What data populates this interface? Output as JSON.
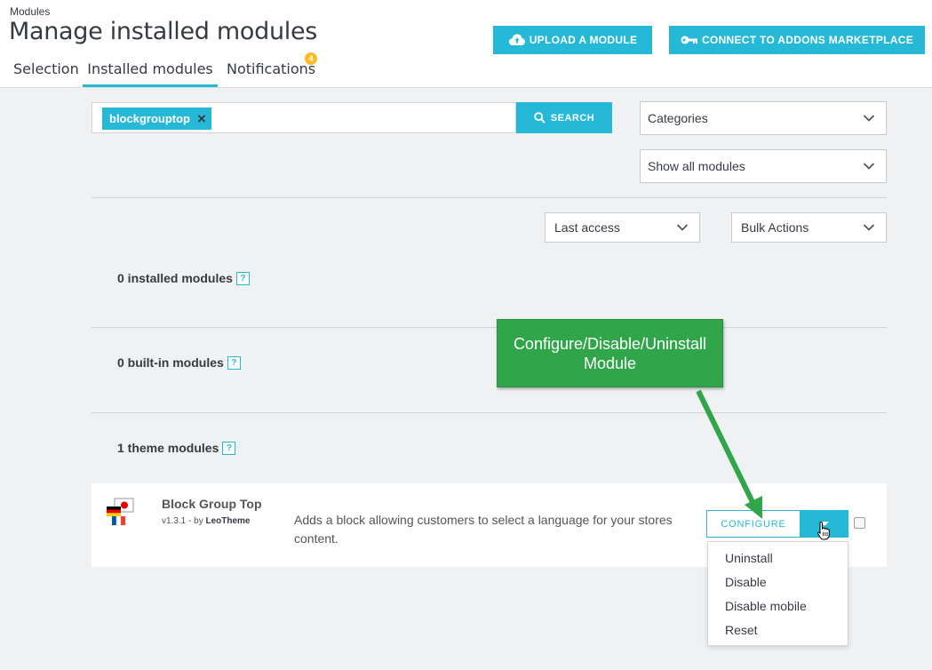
{
  "header": {
    "breadcrumb": "Modules",
    "title": "Manage installed modules",
    "tabs": [
      {
        "label": "Selection",
        "active": false
      },
      {
        "label": "Installed modules",
        "active": true
      },
      {
        "label": "Notifications",
        "active": false
      }
    ],
    "notification_count": "4",
    "upload_label": "UPLOAD A MODULE",
    "connect_label": "CONNECT TO ADDONS MARKETPLACE",
    "accent_color": "#25b9d7"
  },
  "filters": {
    "search_tag": "blockgrouptop",
    "search_label": "SEARCH",
    "categories": "Categories",
    "show_all": "Show all modules",
    "sort": "Last access",
    "bulk_actions": "Bulk Actions"
  },
  "sections": [
    {
      "title": "0 installed modules"
    },
    {
      "title": "0 built-in modules"
    },
    {
      "title": "1 theme modules"
    }
  ],
  "module": {
    "name": "Block Group Top",
    "version": "v1.3.1 - by",
    "author": "LeoTheme",
    "description": "Adds a block allowing customers to select a language for your stores content.",
    "configure_label": "CONFIGURE",
    "actions": [
      "Uninstall",
      "Disable",
      "Disable mobile",
      "Reset"
    ]
  },
  "annotation": {
    "line1": "Configure/Disable/Uninstall",
    "line2": "Module",
    "color": "#30a54a"
  }
}
